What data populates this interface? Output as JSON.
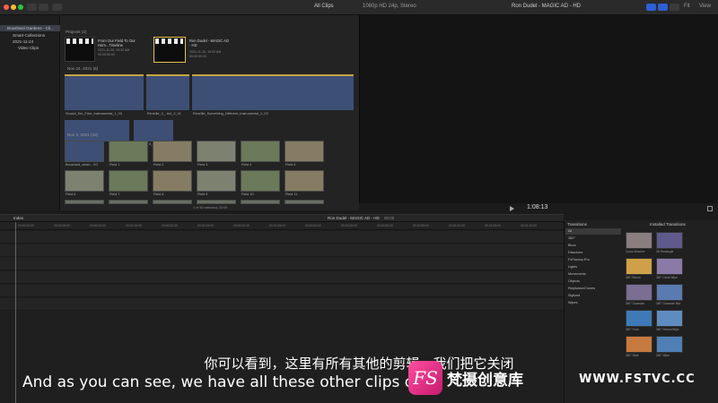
{
  "toolbar": {
    "browser_filter": "All Clips",
    "format": "1080p HD 24p, Stereo",
    "project_name": "Ron Dudel - MAGIC AD - HD",
    "fit": "Fit",
    "view": "View"
  },
  "sidebar": {
    "items": [
      {
        "label": "Boushard Gardens - Cli..."
      },
      {
        "label": "Smart Collections"
      },
      {
        "label": "2021-11-24"
      },
      {
        "label": "Video Clips"
      }
    ]
  },
  "browser": {
    "projects_header": "Projects",
    "projects_count": "(2)",
    "projects": [
      {
        "title": "From Our Field To Our Hom...Timeline",
        "meta": "2021-11-26, 10:32 AM\n00:00:50:00"
      },
      {
        "title": "Ron Dudel - MAGIC AD - HD",
        "meta": "2021-11-26, 10:02 AM\n00:00:00:00"
      }
    ],
    "nov24_header": "Nov 24, 2021",
    "nov24_count": "(6)",
    "audio_clips": [
      {
        "label": "Smack_Em_Free_Instrumental_1_03"
      },
      {
        "label": "Reveille_3_..but_2_01"
      },
      {
        "label": "Reveille_Something_Different_Instrumental_2_03"
      },
      {
        "label": "Boushard_clean - VO"
      },
      {
        "label": "BETTER 5_clean - VO"
      }
    ],
    "nov3_header": "Nov 3, 2021",
    "nov3_count": "(43)",
    "video_clips": [
      {
        "label": "Boushard_clean - VO"
      },
      {
        "label": "Field 1"
      },
      {
        "label": "Field 2"
      },
      {
        "label": "Field 3"
      },
      {
        "label": "Field 4"
      },
      {
        "label": "Field 5"
      },
      {
        "label": "Field 6"
      },
      {
        "label": "Field 7"
      },
      {
        "label": "Field 8"
      },
      {
        "label": "Field 9"
      },
      {
        "label": "Field 10"
      },
      {
        "label": "Field 11"
      }
    ],
    "selection_status": "1 of 50 selected, 20:00"
  },
  "viewer": {
    "timecode": "1:08:13"
  },
  "timeline": {
    "index_label": "Index",
    "project_name": "Ron Dudel - MAGIC AD - HD",
    "duration": "00:00",
    "ruler": [
      "00:00:00:00",
      "00:00:05:00",
      "00:00:10:00",
      "00:00:15:00",
      "00:00:20:00",
      "00:00:25:00",
      "00:00:30:00",
      "00:00:35:00",
      "00:00:40:00",
      "00:00:45:00",
      "00:00:50:00",
      "00:00:55:00",
      "00:01:00:00",
      "00:01:05:00",
      "00:01:10:00"
    ]
  },
  "transitions": {
    "header": "Transitions",
    "installed": "Installed Transitions",
    "categories": [
      "All",
      "360°",
      "Blurs",
      "Dissolves",
      "FxFactory Pro",
      "Lights",
      "Movements",
      "Objects",
      "Replicator/Clones",
      "Stylized",
      "Wipes"
    ],
    "tiles": [
      {
        "label": "Cross Dissolve"
      },
      {
        "label": "3D Rectangle"
      },
      {
        "label": "360° Bloom"
      },
      {
        "label": "360° Circle Wipe"
      },
      {
        "label": "360° Gaussian"
      },
      {
        "label": "360° Gaussian Blur"
      },
      {
        "label": "360° Push"
      },
      {
        "label": "360° Reveal Wipe"
      },
      {
        "label": "360° Slide"
      },
      {
        "label": "360° Wipe"
      }
    ]
  },
  "subtitles": {
    "chinese": "你可以看到，这里有所有其他的剪辑，我们把它关闭",
    "english": "And as you can see, we have all these other clips over"
  },
  "watermark": {
    "logo": "FS",
    "brand": "梵摄创意库",
    "site": "WWW.FSTVC.CC"
  },
  "colors": {
    "accent": "#2e5fd6",
    "waveform": "#3d4f75",
    "peak": "#c6a33f",
    "selection": "#e3c34a"
  }
}
